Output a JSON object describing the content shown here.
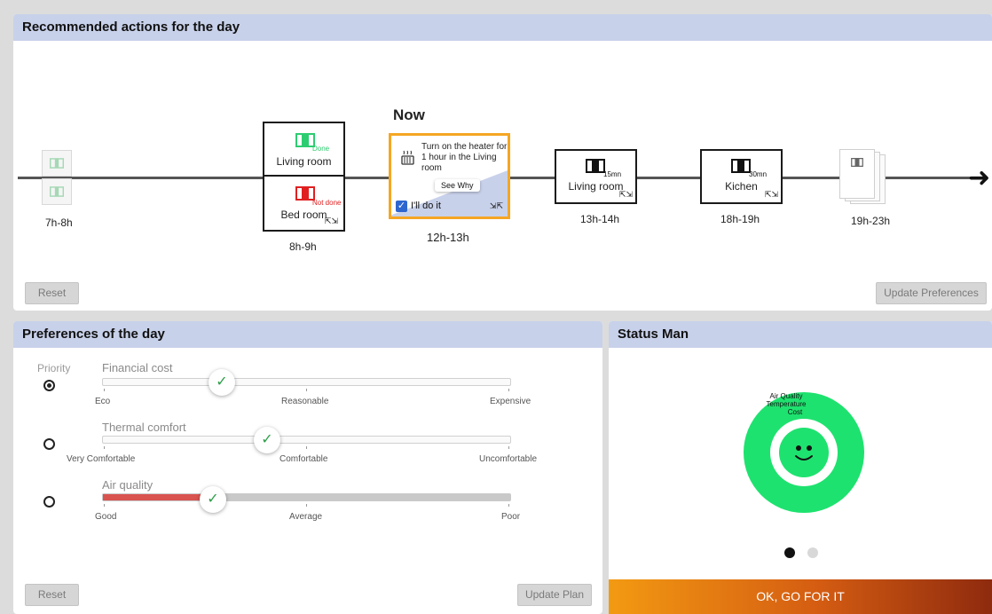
{
  "timeline": {
    "title": "Recommended actions for the day",
    "now_label": "Now",
    "slots": [
      {
        "time": "7h-8h"
      },
      {
        "time": "8h-9h",
        "rooms": [
          {
            "name": "Living room",
            "badge": "Done"
          },
          {
            "name": "Bed room",
            "badge": "Not done"
          }
        ]
      },
      {
        "time": "12h-13h",
        "action_text": "Turn on the heater for 1 hour in the Living room",
        "see_why": "See Why",
        "checkbox_label": "I'll do it",
        "checked": true
      },
      {
        "time": "13h-14h",
        "room": "Living room",
        "duration": "15mn"
      },
      {
        "time": "18h-19h",
        "room": "Kichen",
        "duration": "30mn"
      },
      {
        "time": "19h-23h"
      }
    ],
    "reset_label": "Reset",
    "update_label": "Update Preferences"
  },
  "preferences": {
    "title": "Preferences of the day",
    "priority_label": "Priority",
    "sliders": [
      {
        "name": "Financial cost",
        "labels": [
          "Eco",
          "Reasonable",
          "Expensive"
        ],
        "value": 0.29,
        "priority": true
      },
      {
        "name": "Thermal comfort",
        "labels": [
          "Very Comfortable",
          "Comfortable",
          "Uncomfortable"
        ],
        "value": 0.4,
        "priority": false
      },
      {
        "name": "Air quality",
        "labels": [
          "Good",
          "Average",
          "Poor"
        ],
        "value": 0.27,
        "priority": false
      }
    ],
    "reset_label": "Reset",
    "update_label": "Update Plan"
  },
  "status": {
    "title": "Status Man",
    "ring_labels": [
      "Air Quality",
      "Temperature",
      "Cost"
    ],
    "page_index": 0,
    "page_count": 2,
    "go_label": "OK, GO FOR IT"
  },
  "colors": {
    "header_bg": "#c8d1ea",
    "now_border": "#f5a623",
    "done": "#2ecc71",
    "not_done": "#e02020",
    "status_green": "#1ee26f",
    "air_red": "#d9534f"
  }
}
